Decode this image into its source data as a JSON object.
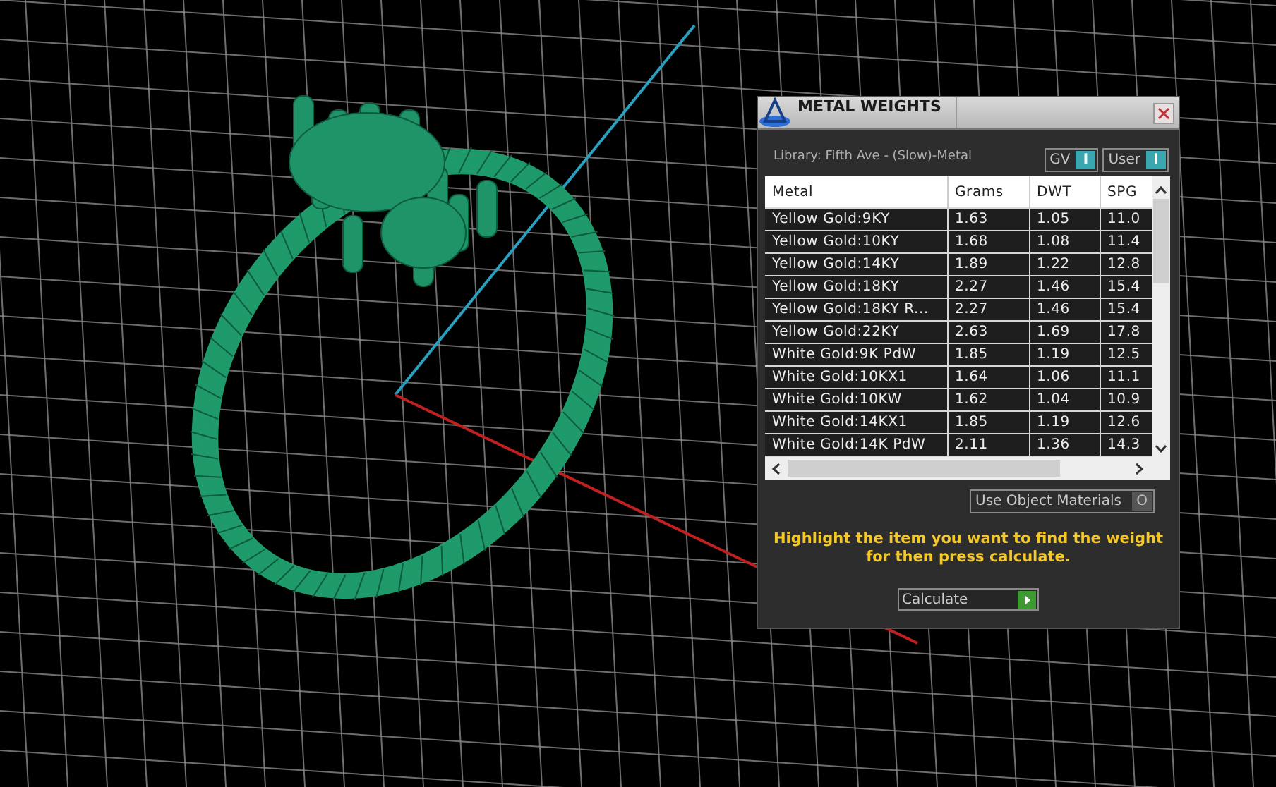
{
  "panel": {
    "title": "METAL WEIGHTS",
    "library": "Library: Fifth Ave - (Slow)-Metal",
    "toggles": [
      {
        "label": "GV",
        "glyph": "I",
        "on": true
      },
      {
        "label": "User",
        "glyph": "I",
        "on": true
      }
    ],
    "table": {
      "columns": [
        "Metal",
        "Grams",
        "DWT",
        "SPG"
      ],
      "rows": [
        [
          "Yellow Gold:9KY",
          "1.63",
          "1.05",
          "11.0"
        ],
        [
          "Yellow Gold:10KY",
          "1.68",
          "1.08",
          "11.4"
        ],
        [
          "Yellow Gold:14KY",
          "1.89",
          "1.22",
          "12.8"
        ],
        [
          "Yellow Gold:18KY",
          "2.27",
          "1.46",
          "15.4"
        ],
        [
          "Yellow Gold:18KY R...",
          "2.27",
          "1.46",
          "15.4"
        ],
        [
          "Yellow Gold:22KY",
          "2.63",
          "1.69",
          "17.8"
        ],
        [
          "White Gold:9K PdW",
          "1.85",
          "1.19",
          "12.5"
        ],
        [
          "White Gold:10KX1",
          "1.64",
          "1.06",
          "11.1"
        ],
        [
          "White Gold:10KW",
          "1.62",
          "1.04",
          "10.9"
        ],
        [
          "White Gold:14KX1",
          "1.85",
          "1.19",
          "12.6"
        ],
        [
          "White Gold:14K PdW",
          "2.11",
          "1.36",
          "14.3"
        ]
      ]
    },
    "materials_toggle": {
      "label": "Use Object Materials",
      "glyph": "O",
      "on": false
    },
    "message": "Highlight the item you want to find the weight for then press calculate.",
    "calculate_button": {
      "label": "Calculate"
    }
  }
}
